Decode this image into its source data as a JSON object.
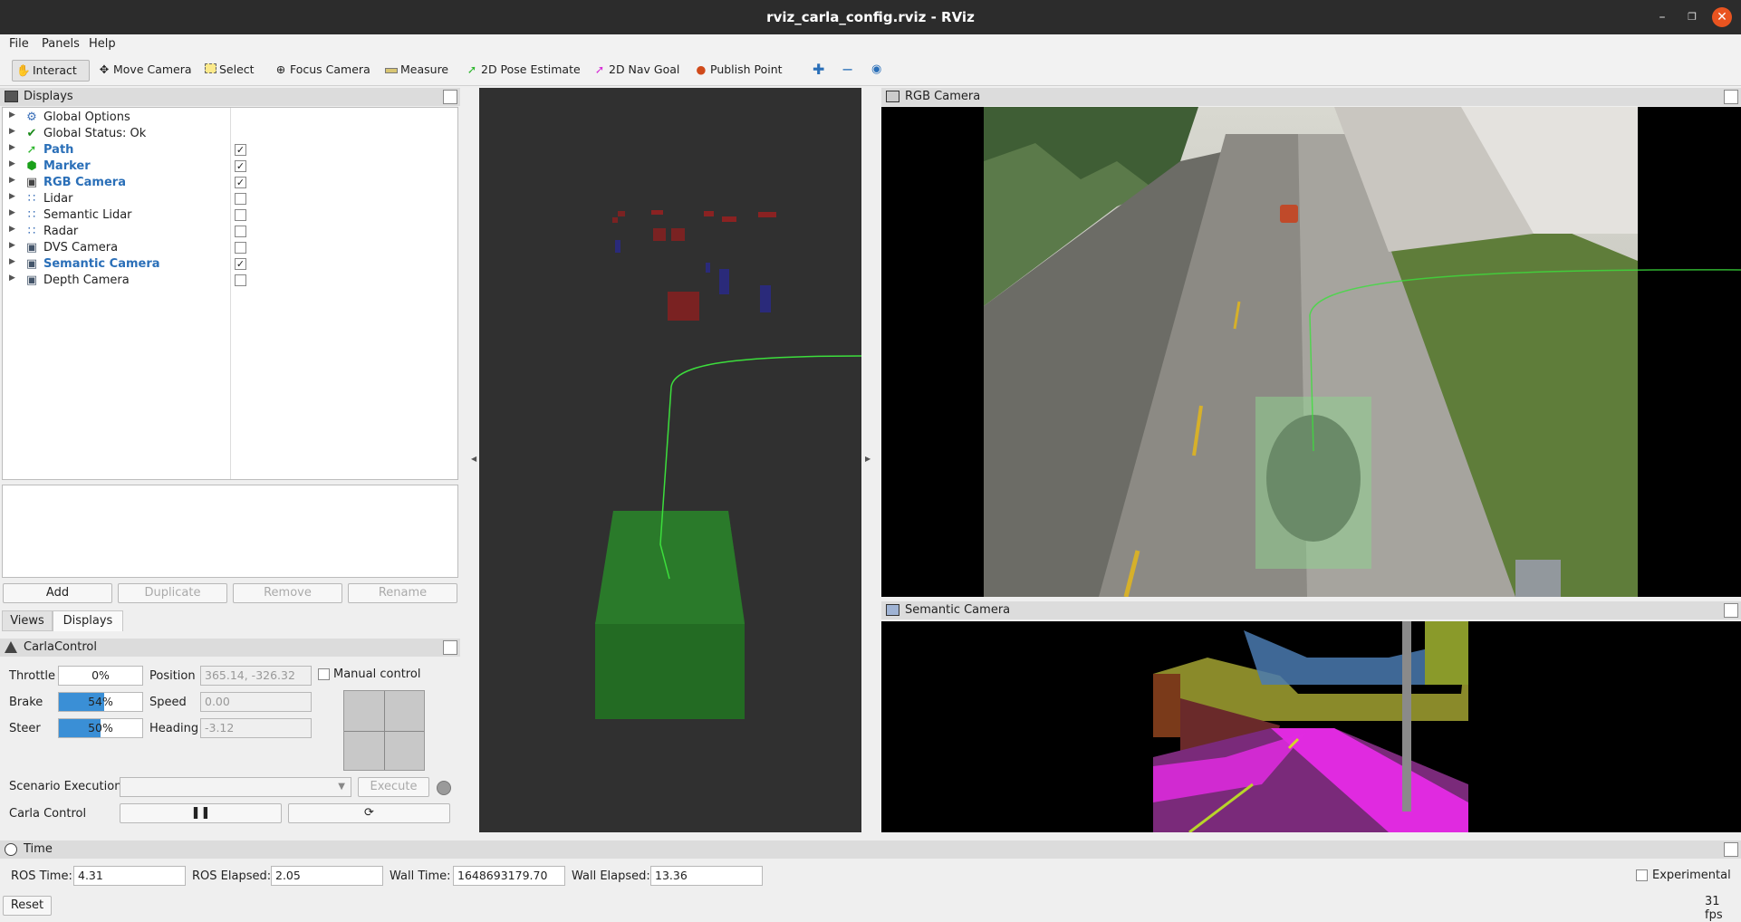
{
  "window": {
    "title": "rviz_carla_config.rviz - RViz"
  },
  "menu": [
    "File",
    "Panels",
    "Help"
  ],
  "toolbar": {
    "interact": "Interact",
    "move_camera": "Move Camera",
    "select": "Select",
    "focus_camera": "Focus Camera",
    "measure": "Measure",
    "pose_estimate": "2D Pose Estimate",
    "nav_goal": "2D Nav Goal",
    "publish_point": "Publish Point"
  },
  "displays_panel": {
    "title": "Displays",
    "items": [
      {
        "label": "Global Options",
        "icon": "gear-icon",
        "enabled": null,
        "highlight": false
      },
      {
        "label": "Global Status: Ok",
        "icon": "check-icon",
        "enabled": null,
        "highlight": false
      },
      {
        "label": "Path",
        "icon": "path-icon",
        "enabled": true,
        "highlight": true
      },
      {
        "label": "Marker",
        "icon": "marker-icon",
        "enabled": true,
        "highlight": true
      },
      {
        "label": "RGB Camera",
        "icon": "camera-icon",
        "enabled": true,
        "highlight": true
      },
      {
        "label": "Lidar",
        "icon": "pointcloud-icon",
        "enabled": false,
        "highlight": false
      },
      {
        "label": "Semantic Lidar",
        "icon": "pointcloud-icon",
        "enabled": false,
        "highlight": false
      },
      {
        "label": "Radar",
        "icon": "pointcloud-icon",
        "enabled": false,
        "highlight": false
      },
      {
        "label": "DVS Camera",
        "icon": "image-icon",
        "enabled": false,
        "highlight": false
      },
      {
        "label": "Semantic Camera",
        "icon": "image-icon",
        "enabled": true,
        "highlight": true
      },
      {
        "label": "Depth Camera",
        "icon": "image-icon",
        "enabled": false,
        "highlight": false
      }
    ],
    "buttons": {
      "add": "Add",
      "duplicate": "Duplicate",
      "remove": "Remove",
      "rename": "Rename"
    },
    "tabs": {
      "views": "Views",
      "displays": "Displays"
    }
  },
  "carla_control": {
    "title": "CarlaControl",
    "throttle_label": "Throttle",
    "throttle_value": "0%",
    "throttle_fraction": 0,
    "brake_label": "Brake",
    "brake_value": "54%",
    "brake_fraction": 0.54,
    "steer_label": "Steer",
    "steer_value": "50%",
    "steer_fraction": 0.5,
    "position_label": "Position",
    "position_value": "365.14, -326.32",
    "speed_label": "Speed",
    "speed_value": "0.00",
    "heading_label": "Heading",
    "heading_value": "-3.12",
    "manual_label": "Manual control",
    "scenario_label": "Scenario Execution",
    "execute_label": "Execute",
    "carla_control_label": "Carla Control"
  },
  "rgb_panel": {
    "title": "RGB Camera"
  },
  "semantic_panel": {
    "title": "Semantic Camera"
  },
  "time_panel": {
    "title": "Time",
    "ros_time_label": "ROS Time:",
    "ros_time": "4.31",
    "ros_elapsed_label": "ROS Elapsed:",
    "ros_elapsed": "2.05",
    "wall_time_label": "Wall Time:",
    "wall_time": "1648693179.70",
    "wall_elapsed_label": "Wall Elapsed:",
    "wall_elapsed": "13.36",
    "experimental_label": "Experimental",
    "reset_label": "Reset",
    "fps": "31 fps"
  },
  "colors": {
    "accent": "#3a8fd6",
    "highlight_text": "#2a6fb8",
    "marker": "#2b7a2b",
    "path": "#3cde3c",
    "titlebar": "#2c2c2c",
    "close": "#e95420"
  }
}
